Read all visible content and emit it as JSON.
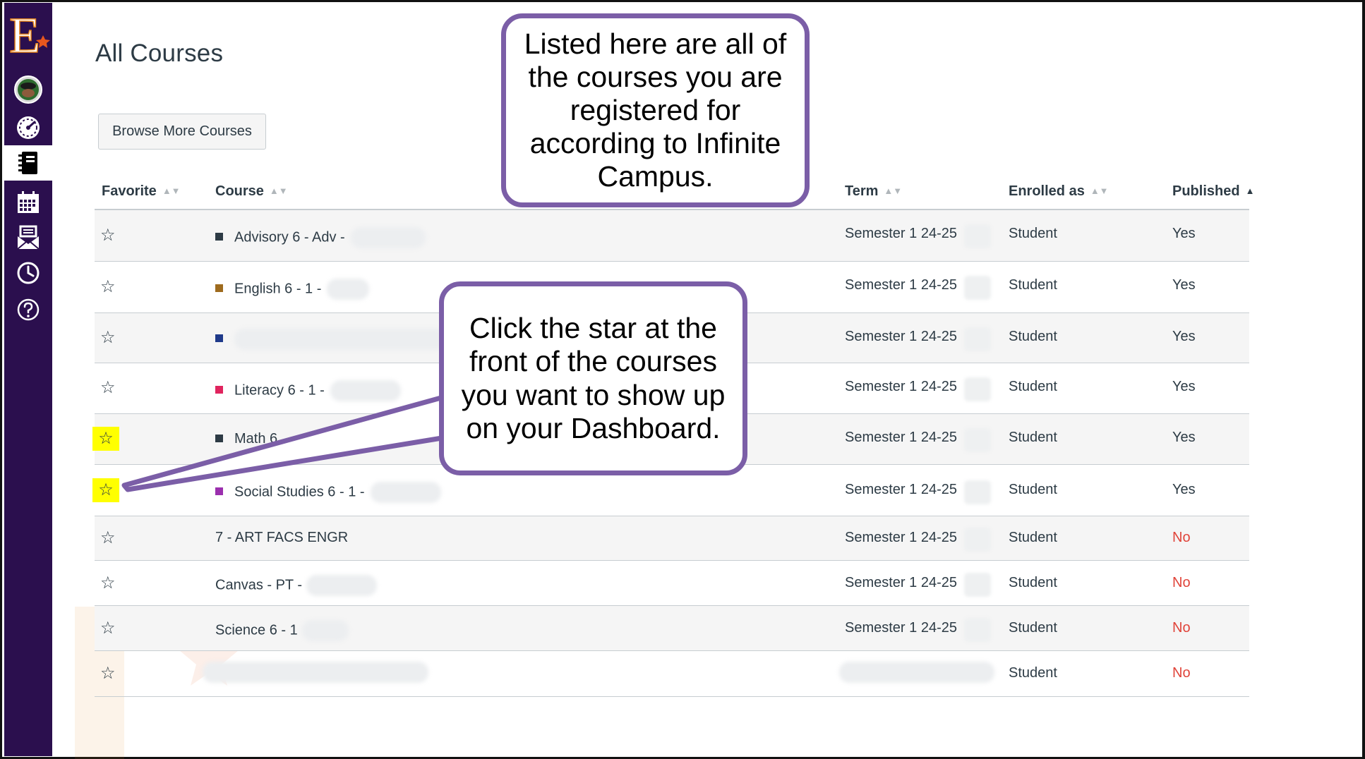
{
  "page": {
    "title": "All Courses",
    "browse_button": "Browse More Courses"
  },
  "sidebar": {
    "items": [
      {
        "name": "account",
        "icon": "avatar-icon"
      },
      {
        "name": "dashboard",
        "icon": "dashboard-gauge-icon"
      },
      {
        "name": "courses",
        "icon": "courses-book-icon",
        "active": true
      },
      {
        "name": "calendar",
        "icon": "calendar-icon"
      },
      {
        "name": "inbox",
        "icon": "inbox-icon"
      },
      {
        "name": "history",
        "icon": "clock-icon"
      },
      {
        "name": "help",
        "icon": "help-icon"
      }
    ],
    "logo_letter": "E"
  },
  "table": {
    "headers": {
      "favorite": "Favorite",
      "course": "Course",
      "term": "Term",
      "enrolled_as": "Enrolled as",
      "published": "Published"
    },
    "rows": [
      {
        "course": "Advisory 6 - Adv -",
        "color": "#2d3b45",
        "term": "Semester 1 24-25",
        "role": "Student",
        "published": "Yes"
      },
      {
        "course": "English 6 - 1 -",
        "color": "#9e6b1e",
        "term": "Semester 1 24-25",
        "role": "Student",
        "published": "Yes"
      },
      {
        "course": "",
        "color": "#1f3a8a",
        "term": "Semester 1 24-25",
        "role": "Student",
        "published": "Yes"
      },
      {
        "course": "Literacy 6 - 1 -",
        "color": "#e0245e",
        "term": "Semester 1 24-25",
        "role": "Student",
        "published": "Yes"
      },
      {
        "course": "Math 6",
        "color": "#2d3b45",
        "term": "Semester 1 24-25",
        "role": "Student",
        "published": "Yes"
      },
      {
        "course": "Social Studies 6 - 1 -",
        "color": "#9b2fae",
        "term": "Semester 1 24-25",
        "role": "Student",
        "published": "Yes"
      },
      {
        "course": "7 - ART FACS ENGR",
        "color": "",
        "term": "Semester 1 24-25",
        "role": "Student",
        "published": "No"
      },
      {
        "course": "Canvas - PT -",
        "color": "",
        "term": "Semester 1 24-25",
        "role": "Student",
        "published": "No"
      },
      {
        "course": "Science 6 - 1",
        "color": "",
        "term": "Semester 1 24-25",
        "role": "Student",
        "published": "No"
      },
      {
        "course": "",
        "color": "",
        "term": "",
        "role": "Student",
        "published": "No"
      }
    ]
  },
  "callouts": {
    "top": "Listed here are all of the courses you are registered for according to Infinite Campus.",
    "bottom": "Click the star at the front of the courses you want to show up on your Dashboard."
  },
  "colors": {
    "sidebar_bg": "#2b0f4e",
    "callout_border": "#7b5ea7",
    "highlight": "#ffff00",
    "published_no": "#e0443a"
  }
}
